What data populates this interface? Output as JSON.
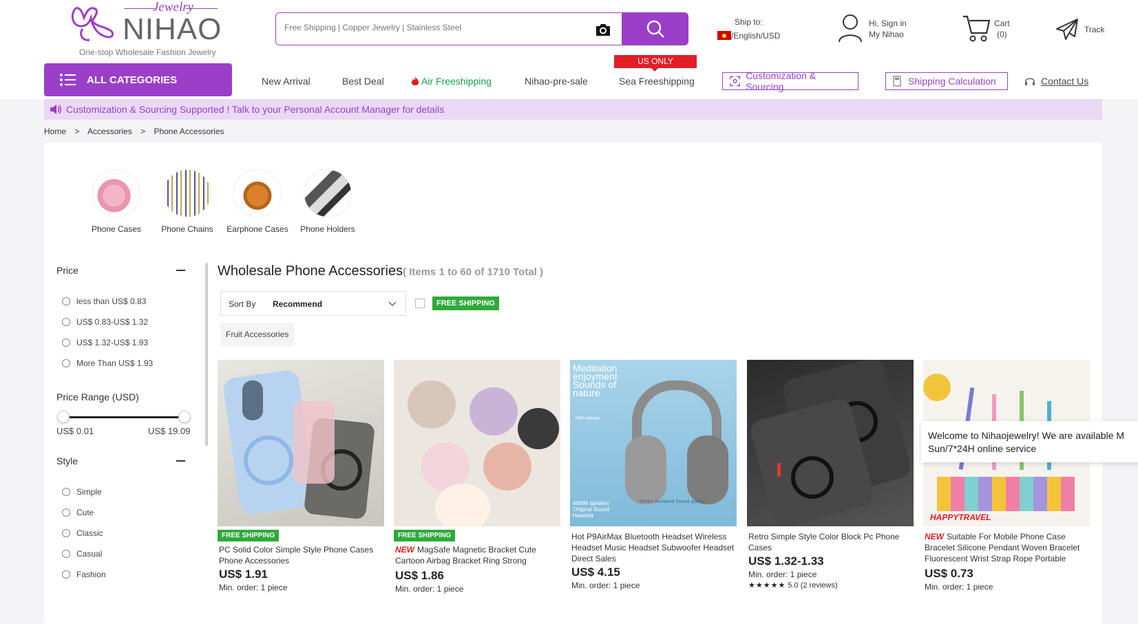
{
  "logo": {
    "script": "Jewelry",
    "word": "NIHAO",
    "tagline": "One-stop Wholesale Fashion Jewelry"
  },
  "search": {
    "placeholder": "Free Shipping | Copper Jewelry | Stainless Steel"
  },
  "header": {
    "ship_label": "Ship to:",
    "ship_value": "/English/USD",
    "sign_in": "Hi, Sign in",
    "my_account": "My Nihao",
    "cart_label": "Cart",
    "cart_count": "(0)",
    "track": "Track"
  },
  "nav": {
    "all_categories": "ALL CATEGORIES",
    "new_arrival": "New Arrival",
    "best_deal": "Best Deal",
    "air_freeshipping": "Air Freeshipping",
    "pre_sale": "Nihao-pre-sale",
    "sea_badge": "US ONLY",
    "sea_freeshipping": "Sea Freeshipping",
    "customization": "Customization & Sourcing",
    "shipping_calc": "Shipping Calculation",
    "contact": "Contact Us"
  },
  "banner": "Customization & Sourcing Supported ! Talk to your Personal Account Manager for details",
  "breadcrumb": {
    "home": "Home",
    "sep": ">",
    "level1": "Accessories",
    "level2": "Phone Accessories"
  },
  "subcategories": [
    "Phone Cases",
    "Phone Chains",
    "Earphone Cases",
    "Phone Holders"
  ],
  "sidebar": {
    "price_title": "Price",
    "price_options": [
      "less than US$ 0.83",
      "US$ 0.83-US$ 1.32",
      "US$ 1.32-US$ 1.93",
      "More Than US$ 1.93"
    ],
    "range_title": "Price Range (USD)",
    "range_min": "US$ 0.01",
    "range_max": "US$ 19.09",
    "style_title": "Style",
    "style_options": [
      "Simple",
      "Cute",
      "Classic",
      "Casual",
      "Fashion"
    ]
  },
  "listing": {
    "title": "Wholesale Phone Accessories",
    "count": "( Items 1 to 60 of 1710 Total )",
    "sort_label": "Sort By",
    "sort_value": "Recommend",
    "free_shipping_tag": "FREE SHIPPING",
    "filter_chip": "Fruit Accessories"
  },
  "products": [
    {
      "badge": "FREE SHIPPING",
      "new": "",
      "title": "PC Solid Color Simple Style Phone Cases Phone Accessories",
      "price": "US$ 1.91",
      "min_order": "Min. order: 1 piece",
      "rating": "",
      "reviews": ""
    },
    {
      "badge": "FREE SHIPPING",
      "new": "NEW",
      "title": "MagSafe Magnetic Bracket Cute Cartoon Airbag Bracket Ring Strong Adsorption Crazy Can Not Throw Off The...",
      "price": "US$ 1.86",
      "min_order": "Min. order: 1 piece",
      "rating": "",
      "reviews": ""
    },
    {
      "badge": "",
      "new": "",
      "title": "Hot P9AirMax Bluetooth Headset Wireless Headset Music Headset Subwoofer Headset Direct Sales",
      "price": "US$ 4.15",
      "min_order": "Min. order: 1 piece",
      "rating": "",
      "reviews": ""
    },
    {
      "badge": "",
      "new": "",
      "title": "Retro Simple Style Color Block Pc Phone Cases",
      "price": "US$ 1.32-1.33",
      "min_order": "Min. order: 1 piece",
      "rating": "5.0",
      "reviews": "(2 reviews)"
    },
    {
      "badge": "",
      "new": "NEW",
      "title": "Suitable For Mobile Phone Case Bracelet Silicone Pendant Woven Bracelet Fluorescent Wrist Strap Rope Portable Ring...",
      "price": "US$ 0.73",
      "min_order": "Min. order: 1 piece",
      "rating": "",
      "reviews": ""
    }
  ],
  "product_image_text": {
    "headset_line1": "Meditation",
    "headset_line2": "enjoyment",
    "headset_line3": "Sounds of",
    "headset_line4": "nature",
    "headset_spec": "HIFI stereo",
    "headset_speaker": "40MM speaker",
    "headset_sound1": "Original Sound",
    "headset_sound2": "Headset",
    "headset_surround": "Stereo Surround Sound quality",
    "travel_logo": "HAPPYTRAVEL"
  },
  "chat": {
    "line1": "Welcome to Nihaojewelry! We are available M",
    "line2": "Sun/7*24H online service"
  },
  "colors": {
    "brand": "#9b3fc9",
    "free_shipping": "#2eaa3a",
    "new": "#e31b1b",
    "us_only": "#e41e26"
  }
}
